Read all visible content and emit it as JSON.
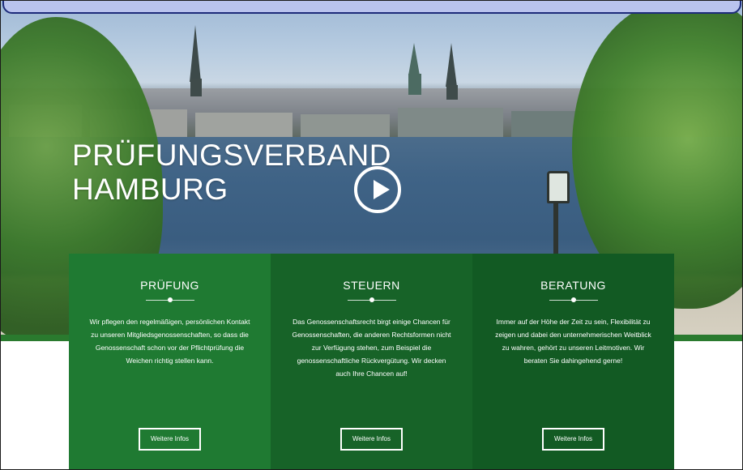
{
  "hero": {
    "title_line1": "PRÜFUNGSVERBAND",
    "title_line2": "HAMBURG"
  },
  "icons": {
    "play": "play-icon"
  },
  "cards": [
    {
      "title": "PRÜFUNG",
      "text": "Wir pflegen den regelmäßigen, persönlichen Kontakt zu unseren Mitgliedsgenossenschaften, so dass die Genossenschaft schon vor der Pflichtprüfung die Weichen richtig stellen kann.",
      "button": "Weitere Infos"
    },
    {
      "title": "STEUERN",
      "text": "Das Genossenschaftsrecht birgt einige Chancen für Genossenschaften, die anderen Rechtsformen nicht zur Verfügung stehen, zum Beispiel die genossenschaftliche Rückvergütung. Wir decken auch Ihre Chancen auf!",
      "button": "Weitere Infos"
    },
    {
      "title": "BERATUNG",
      "text": "Immer auf der Höhe der Zeit zu sein, Flexibilität zu zeigen und dabei den unternehmerischen Weitblick zu wahren, gehört zu unseren Leitmotiven. Wir beraten Sie dahingehend gerne!",
      "button": "Weitere Infos"
    }
  ],
  "colors": {
    "card1": "#1f7a32",
    "card2": "#176328",
    "card3": "#125a23",
    "topbar": "#b9c3ee"
  }
}
